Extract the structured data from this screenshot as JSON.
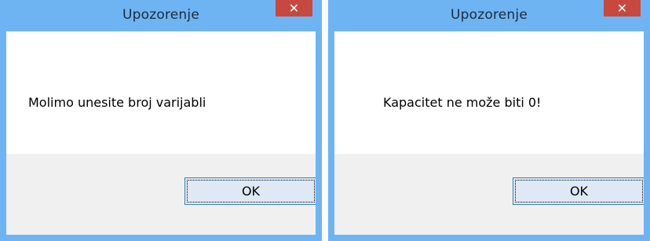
{
  "dialogs": [
    {
      "title": "Upozorenje",
      "close_glyph": "✕",
      "message": "Molimo unesite broj varijabli",
      "ok_label": "OK"
    },
    {
      "title": "Upozorenje",
      "close_glyph": "✕",
      "message": "Kapacitet ne može biti 0!",
      "ok_label": "OK"
    }
  ],
  "colors": {
    "frame": "#6fb4f2",
    "close_button": "#c7483f",
    "footer": "#f0f0f0",
    "button_border": "#3c7fb1"
  }
}
